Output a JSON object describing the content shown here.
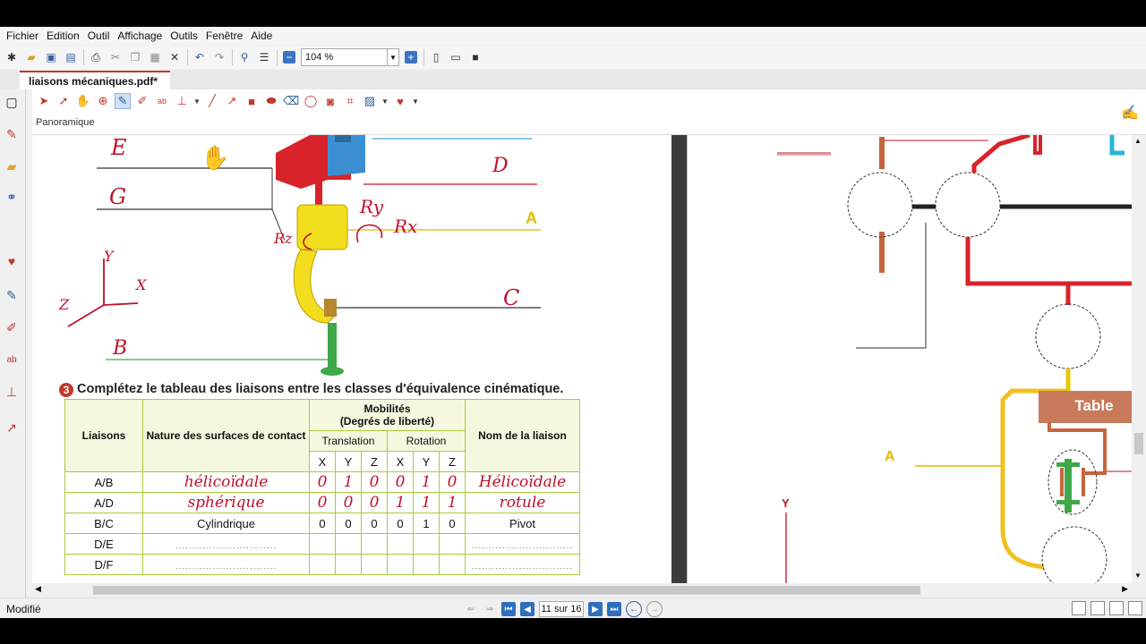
{
  "menu": [
    "Fichier",
    "Edition",
    "Outil",
    "Affichage",
    "Outils",
    "Fenêtre",
    "Aide"
  ],
  "toolbar": {
    "zoom": "104 %"
  },
  "tab": {
    "title": "liaisons mécaniques.pdf*"
  },
  "annot_toolbar": {
    "mode_label": "Panoramique"
  },
  "document": {
    "labels": {
      "E": "E",
      "G": "G",
      "D": "D",
      "A": "A",
      "C": "C",
      "B": "B",
      "ry": "Ry",
      "rx": "Rx",
      "rz": "Rz",
      "x": "X",
      "y": "Y",
      "z": "Z"
    },
    "exercise_number": "3",
    "exercise_title": "Complétez le tableau des liaisons entre les classes d'équivalence cinématique.",
    "table": {
      "col_liaisons": "Liaisons",
      "col_nature": "Nature des surfaces de contact",
      "col_mobilites": "Mobilités",
      "col_mobilites_sub": "(Degrés de liberté)",
      "col_translation": "Translation",
      "col_rotation": "Rotation",
      "col_nom": "Nom de la liaison",
      "axes": [
        "X",
        "Y",
        "Z",
        "X",
        "Y",
        "Z"
      ],
      "rows": [
        {
          "liaison": "A/B",
          "nature": "hélicoïdale",
          "dof": [
            "0",
            "1",
            "0",
            "0",
            "1",
            "0"
          ],
          "nom": "Hélicoïdale",
          "handwritten": true
        },
        {
          "liaison": "A/D",
          "nature": "sphérique",
          "dof": [
            "0",
            "0",
            "0",
            "1",
            "1",
            "1"
          ],
          "nom": "rotule",
          "handwritten": true
        },
        {
          "liaison": "B/C",
          "nature": "Cylindrique",
          "dof": [
            "0",
            "0",
            "0",
            "0",
            "1",
            "0"
          ],
          "nom": "Pivot",
          "handwritten": false
        },
        {
          "liaison": "D/E",
          "nature": "",
          "dof": [
            "",
            "",
            "",
            "",
            "",
            ""
          ],
          "nom": "",
          "handwritten": false
        },
        {
          "liaison": "D/F",
          "nature": "",
          "dof": [
            "",
            "",
            "",
            "",
            "",
            ""
          ],
          "nom": "",
          "handwritten": false
        }
      ]
    },
    "right_page": {
      "table_label": "Table",
      "label_A": "A",
      "label_Y": "Y"
    }
  },
  "status": {
    "text": "Modifié",
    "page": "11 sur 16"
  },
  "colors": {
    "accent": "#c0392b",
    "table_border": "#a8cc3c",
    "ink": "#c0102a"
  }
}
